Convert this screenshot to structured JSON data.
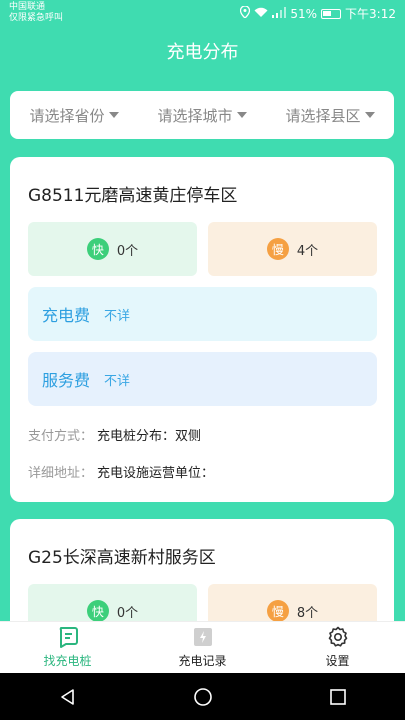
{
  "status": {
    "carrier_line1": "中国联通",
    "carrier_line2": "仅限紧急呼叫",
    "battery": "51%",
    "time": "下午3:12"
  },
  "header": {
    "title": "充电分布"
  },
  "filters": {
    "province": "请选择省份",
    "city": "请选择城市",
    "county": "请选择县区"
  },
  "stations": [
    {
      "name": "G8511元磨高速黄庄停车区",
      "fast_badge": "快",
      "fast_count": "0个",
      "slow_badge": "慢",
      "slow_count": "4个",
      "charge_fee_label": "充电费",
      "charge_fee_value": "不详",
      "service_fee_label": "服务费",
      "service_fee_value": "不详",
      "payment_label": "支付方式：",
      "payment_value": "充电桩分布：双侧",
      "address_label": "详细地址：",
      "address_value": "充电设施运营单位："
    },
    {
      "name": "G25长深高速新村服务区",
      "fast_badge": "快",
      "fast_count": "0个",
      "slow_badge": "慢",
      "slow_count": "8个"
    }
  ],
  "tabs": [
    {
      "label": "找充电桩",
      "icon": "chat-square-icon"
    },
    {
      "label": "充电记录",
      "icon": "charge-record-icon"
    },
    {
      "label": "设置",
      "icon": "gear-icon"
    }
  ],
  "colors": {
    "accent": "#3fdcb0",
    "active_tab": "#2bb67f",
    "fee_text": "#2d9fe0"
  }
}
